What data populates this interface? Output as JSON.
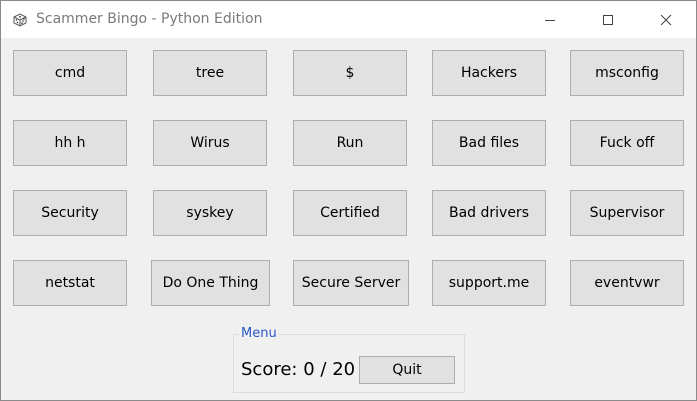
{
  "window": {
    "title": "Scammer Bingo - Python Edition",
    "icon": "dice-icon"
  },
  "grid": {
    "rows": [
      [
        "cmd",
        "tree",
        "$",
        "Hackers",
        "msconfig"
      ],
      [
        "hh h",
        "Wirus",
        "Run",
        "Bad files",
        "Fuck off"
      ],
      [
        "Security",
        "syskey",
        "Certified",
        "Bad drivers",
        "Supervisor"
      ],
      [
        "netstat",
        "Do One Thing",
        "Secure Server",
        "support.me",
        "eventvwr"
      ]
    ]
  },
  "menu": {
    "label": "Menu",
    "score_label": "Score:",
    "score_value": "0",
    "score_separator": "/",
    "score_total": "20",
    "quit_label": "Quit"
  },
  "colors": {
    "menu_label": "#2b58c8",
    "button_bg": "#e1e1e1",
    "window_bg": "#f0f0f0"
  }
}
